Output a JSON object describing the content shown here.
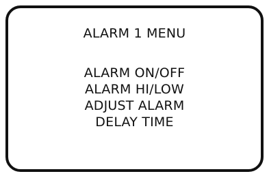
{
  "menu": {
    "title": "ALARM 1 MENU",
    "items": [
      "ALARM ON/OFF",
      "ALARM HI/LOW",
      "ADJUST ALARM",
      "DELAY TIME"
    ]
  }
}
